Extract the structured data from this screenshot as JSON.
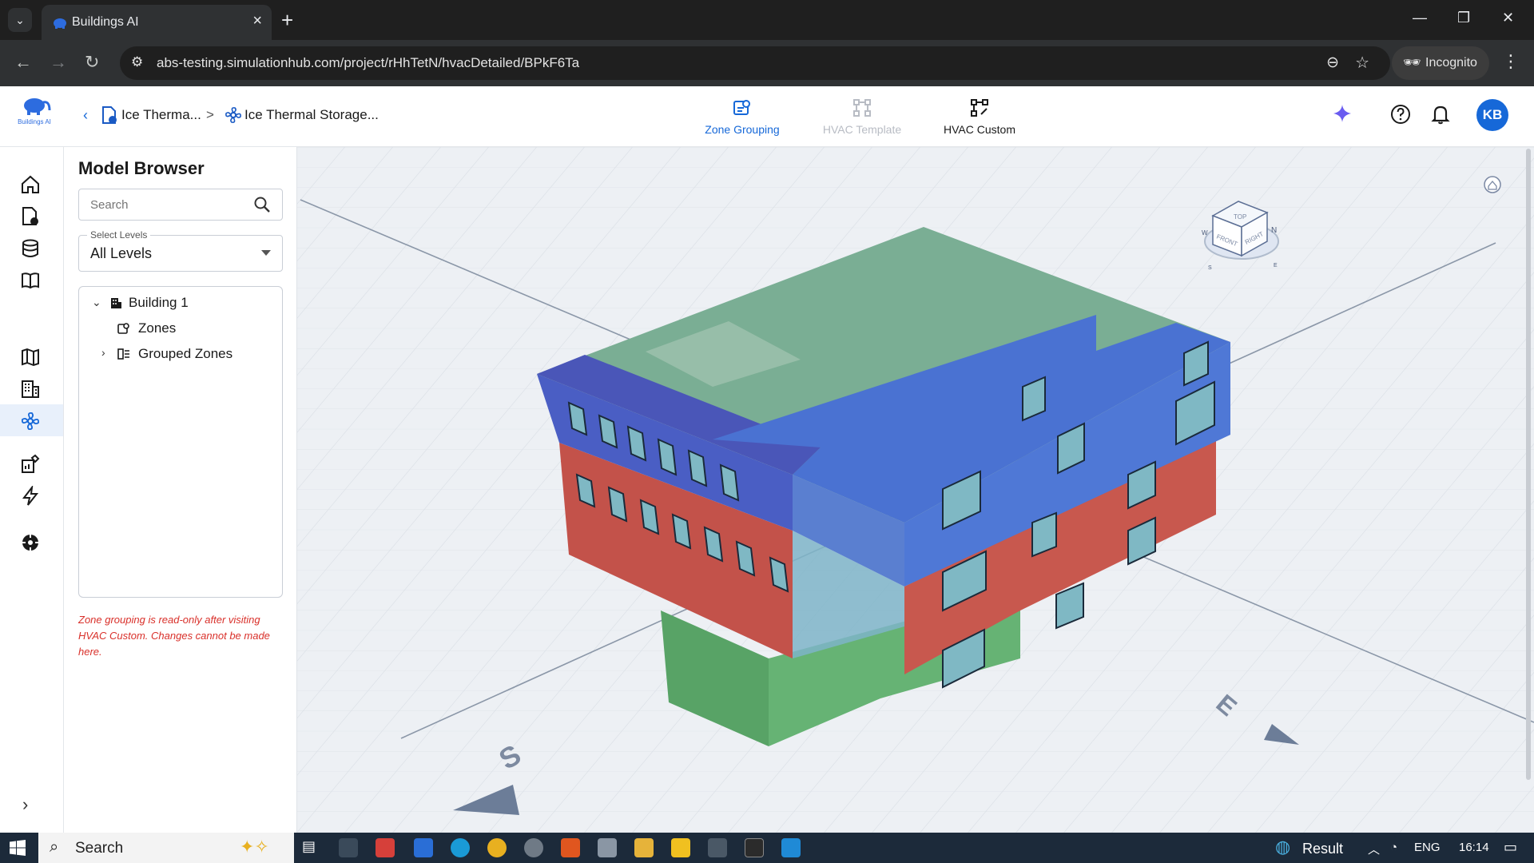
{
  "browser": {
    "tab_title": "Buildings AI",
    "url": "abs-testing.simulationhub.com/project/rHhTetN/hvacDetailed/BPkF6Ta",
    "incognito_label": "Incognito"
  },
  "app": {
    "logo_text": "Buildings AI",
    "breadcrumb": {
      "item1": "Ice Therma...",
      "separator": ">",
      "item2": "Ice Thermal Storage..."
    },
    "nav": [
      {
        "label": "Zone Grouping",
        "state": "active-link"
      },
      {
        "label": "HVAC Template",
        "state": "disabled"
      },
      {
        "label": "HVAC Custom",
        "state": "current"
      }
    ],
    "avatar_initials": "KB"
  },
  "model_browser": {
    "title": "Model Browser",
    "search_placeholder": "Search",
    "levels_label": "Select Levels",
    "levels_value": "All Levels",
    "tree": {
      "building": "Building 1",
      "zones": "Zones",
      "grouped_zones": "Grouped Zones"
    },
    "readonly_note": "Zone grouping is read-only after visiting HVAC Custom. Changes cannot be made here."
  },
  "viewport": {
    "compass": {
      "S": "S",
      "E": "E"
    },
    "viewcube": {
      "top": "TOP",
      "front": "FRONT",
      "right": "RIGHT",
      "n": "N",
      "w": "W",
      "s": "S",
      "e": "E"
    }
  },
  "taskbar": {
    "search_text": "Search",
    "result_label": "Result",
    "lang": "ENG",
    "time": "16:14"
  },
  "colors": {
    "accent": "#1668d8",
    "roof_blue": "#4a72d2",
    "zone_green": "#5fae6a",
    "zone_red": "#c8584e",
    "roof_green": "#7aae94",
    "note_red": "#d9302a"
  }
}
